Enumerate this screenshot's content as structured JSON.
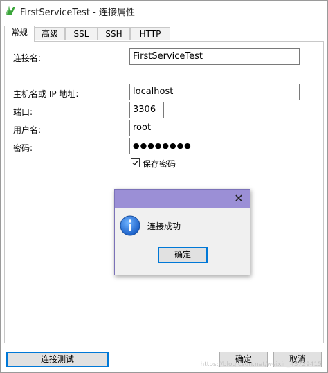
{
  "window": {
    "title": "FirstServiceTest - 连接属性",
    "icon": "navicat-icon"
  },
  "tabs": [
    {
      "label": "常规",
      "active": true
    },
    {
      "label": "高级",
      "active": false
    },
    {
      "label": "SSL",
      "active": false
    },
    {
      "label": "SSH",
      "active": false
    },
    {
      "label": "HTTP",
      "active": false
    }
  ],
  "form": {
    "connection_name_label": "连接名:",
    "connection_name_value": "FirstServiceTest",
    "host_label": "主机名或 IP 地址:",
    "host_value": "localhost",
    "port_label": "端口:",
    "port_value": "3306",
    "username_label": "用户名:",
    "username_value": "root",
    "password_label": "密码:",
    "password_value": "●●●●●●●●",
    "save_password_label": "保存密码",
    "save_password_checked": true
  },
  "dialog": {
    "message": "连接成功",
    "ok_label": "确定",
    "title_color": "#9b8fd6"
  },
  "buttons": {
    "test_connection": "连接测试",
    "ok": "确定",
    "cancel": "取消"
  },
  "watermark": "https://blog.csdn.net/weixin_43729415"
}
